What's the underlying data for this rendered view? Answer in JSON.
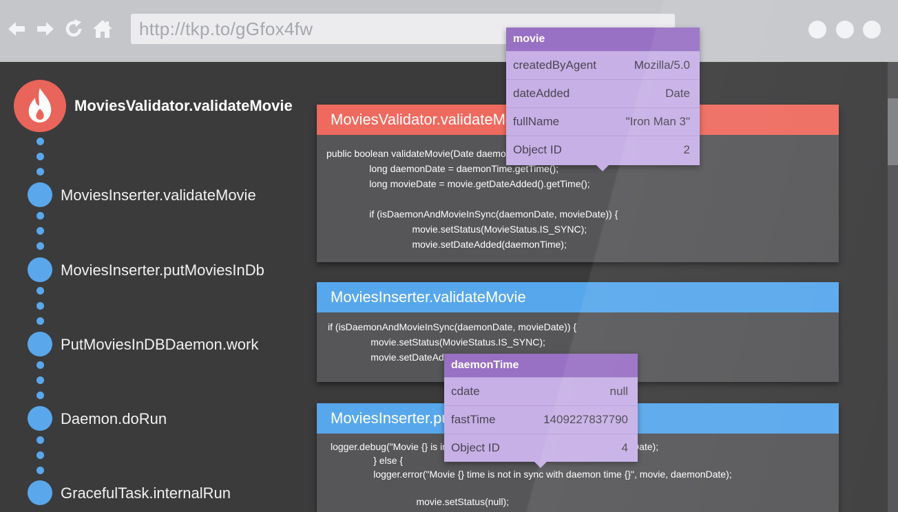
{
  "browser": {
    "url": "http://tkp.to/gGfox4fw"
  },
  "stack": {
    "main": "MoviesValidator.validateMovie",
    "frames": [
      "MoviesInserter.validateMovie",
      "MoviesInserter.putMoviesInDb",
      "PutMoviesInDBDaemon.work",
      "Daemon.doRun",
      "GracefulTask.internalRun"
    ]
  },
  "panels": [
    {
      "title": "MoviesValidator.validateMovie",
      "lines": [
        "public boolean validateMovie(Date daemonTime, Movie movie) {",
        "                long daemonDate = daemonTime.getTime();",
        "                long movieDate = movie.getDateAdded().getTime();",
        "",
        "                if (isDaemonAndMovieInSync(daemonDate, movieDate)) {",
        "                                movie.setStatus(MovieStatus.IS_SYNC);",
        "                                movie.setDateAdded(daemonTime);"
      ]
    },
    {
      "title": "MoviesInserter.validateMovie",
      "lines": [
        "if (isDaemonAndMovieInSync(daemonDate, movieDate)) {",
        "                movie.setStatus(MovieStatus.IS_SYNC);",
        "                movie.setDateAdded(daemonTime);"
      ]
    },
    {
      "title": "MoviesInserter.putMoviesInDb",
      "lines": [
        "logger.debug(\"Movie {} is in sync with daemon time {}\", movie, daemonDate);",
        "                } else {",
        "                logger.error(\"Movie {} time is not in sync with daemon time {}\", movie, daemonDate);",
        "",
        "                                movie.setStatus(null);"
      ]
    }
  ],
  "popups": {
    "movie": {
      "title": "movie",
      "rows": [
        {
          "key": "createdByAgent",
          "value": "Mozilla/5.0"
        },
        {
          "key": "dateAdded",
          "value": "Date"
        },
        {
          "key": "fullName",
          "value": "\"Iron Man 3\""
        },
        {
          "key": "Object ID",
          "value": "2"
        }
      ]
    },
    "daemonTime": {
      "title": "daemonTime",
      "rows": [
        {
          "key": "cdate",
          "value": "null"
        },
        {
          "key": "fastTime",
          "value": "1409227837790"
        },
        {
          "key": "Object ID",
          "value": "4"
        }
      ]
    }
  },
  "icons": {
    "back": "back-arrow-icon",
    "forward": "forward-arrow-icon",
    "reload": "reload-icon",
    "home": "home-icon",
    "flame": "flame-icon"
  },
  "colors": {
    "background": "#3b3b3c",
    "topbar": "#c4c6ca",
    "accent_red": "#ee6a5e",
    "accent_blue": "#57a7ec",
    "popup_header": "#9870c4",
    "popup_body": "#c7b0e6"
  }
}
